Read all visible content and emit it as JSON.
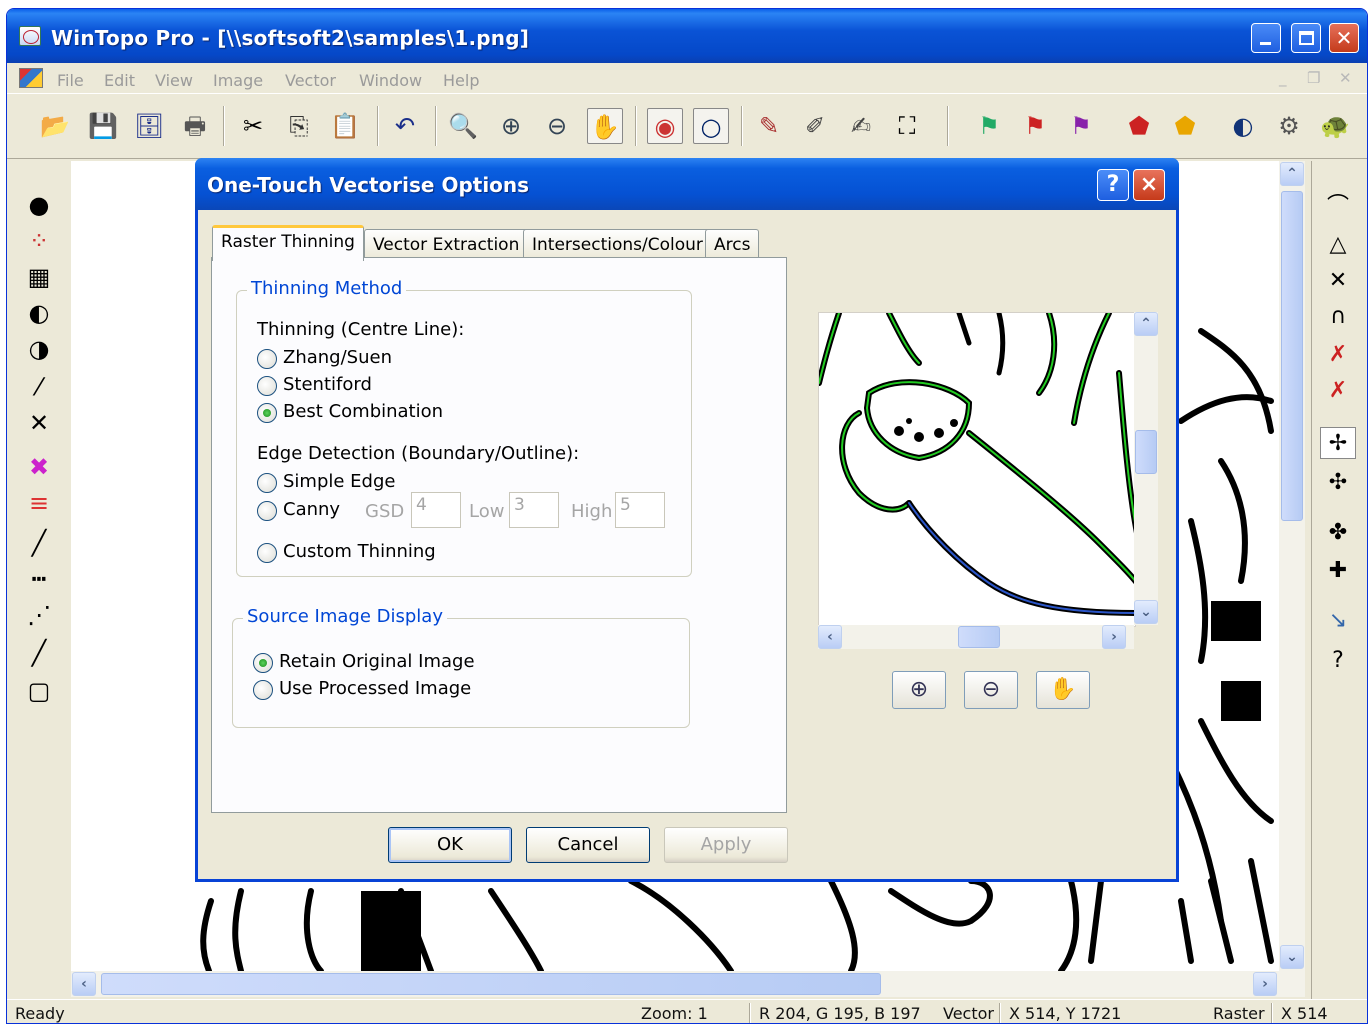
{
  "app": {
    "title": "WinTopo Pro - [\\\\softsoft2\\samples\\1.png]",
    "menu": [
      "File",
      "Edit",
      "View",
      "Image",
      "Vector",
      "Window",
      "Help"
    ]
  },
  "toolbar": {
    "icons": [
      "open-icon",
      "save-icon",
      "save-all-icon",
      "print-icon",
      "cut-icon",
      "copy-icon",
      "paste-icon",
      "undo-icon",
      "magnifier-icon",
      "zoom-in-icon",
      "zoom-out-icon",
      "hand-pan-icon",
      "vectorise-view-icon",
      "outline-view-icon",
      "pencil-icon",
      "eraser-icon",
      "edit-icon",
      "crop-icon",
      "layer-1-icon",
      "layer-2-icon",
      "layer-3-icon",
      "fill-red-icon",
      "fill-yellow-icon",
      "one-touch-icon",
      "settings-icon",
      "tortoise-icon"
    ]
  },
  "status": {
    "ready": "Ready",
    "zoom": "Zoom: 1",
    "rgb": "R 204, G 195, B 197",
    "vector_label": "Vector",
    "vector_coords": "X 514, Y 1721",
    "raster_label": "Raster",
    "raster_coords": "X 514"
  },
  "dialog": {
    "title": "One-Touch Vectorise Options",
    "help_glyph": "?",
    "close_glyph": "×",
    "tabs": [
      "Raster Thinning",
      "Vector Extraction",
      "Intersections/Colour",
      "Arcs"
    ],
    "thinning_method": {
      "legend": "Thinning Method",
      "centre_line_label": "Thinning (Centre Line):",
      "options": [
        "Zhang/Suen",
        "Stentiford",
        "Best Combination"
      ],
      "selected": "Best Combination",
      "edge_label": "Edge Detection (Boundary/Outline):",
      "simple_edge": "Simple Edge",
      "canny": "Canny",
      "gsd_label": "GSD",
      "gsd_value": "4",
      "low_label": "Low",
      "low_value": "3",
      "high_label": "High",
      "high_value": "5",
      "custom": "Custom Thinning"
    },
    "source_display": {
      "legend": "Source Image Display",
      "retain": "Retain Original Image",
      "processed": "Use Processed Image",
      "selected": "Retain Original Image"
    },
    "buttons": {
      "ok": "OK",
      "cancel": "Cancel",
      "apply": "Apply"
    }
  }
}
